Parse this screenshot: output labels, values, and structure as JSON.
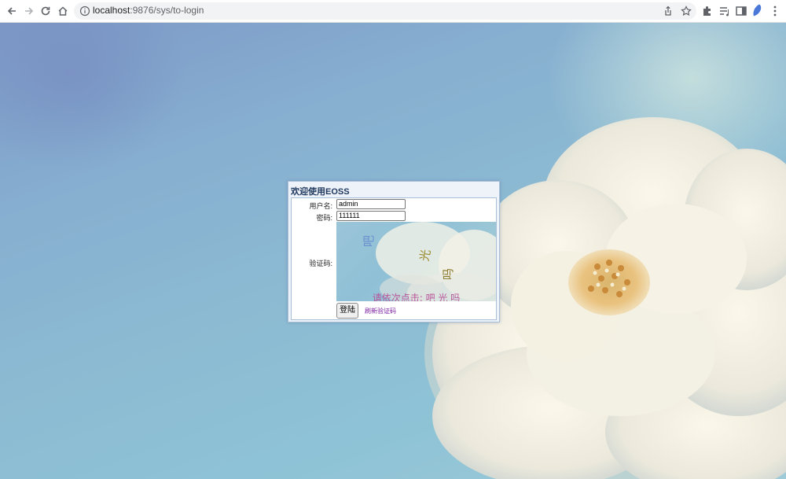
{
  "browser": {
    "url_host": "localhost",
    "url_path": ":9876/sys/to-login",
    "nav_icons": [
      "back-icon",
      "forward-icon",
      "reload-icon",
      "home-icon"
    ],
    "toolbar_icons": [
      "share-icon",
      "bookmark-star-icon",
      "extensions-icon",
      "reading-list-icon",
      "side-panel-icon",
      "profile-icon",
      "menu-icon"
    ]
  },
  "login": {
    "title": "欢迎使用EOSS",
    "username_label": "用户名:",
    "username_value": "admin",
    "password_label": "密码:",
    "password_value": "111111",
    "captcha_label": "验证码:",
    "captcha_chars": [
      "吧",
      "光",
      "吗"
    ],
    "captcha_prompt": "请依次点击: 吧 光 吗",
    "submit_label": "登陆",
    "refresh_label": "刷新验证码"
  },
  "colors": {
    "background": "#8cbad2",
    "panel_title": "#20395e",
    "captcha_prompt": "#b8559a",
    "link": "#7a1fa0"
  }
}
